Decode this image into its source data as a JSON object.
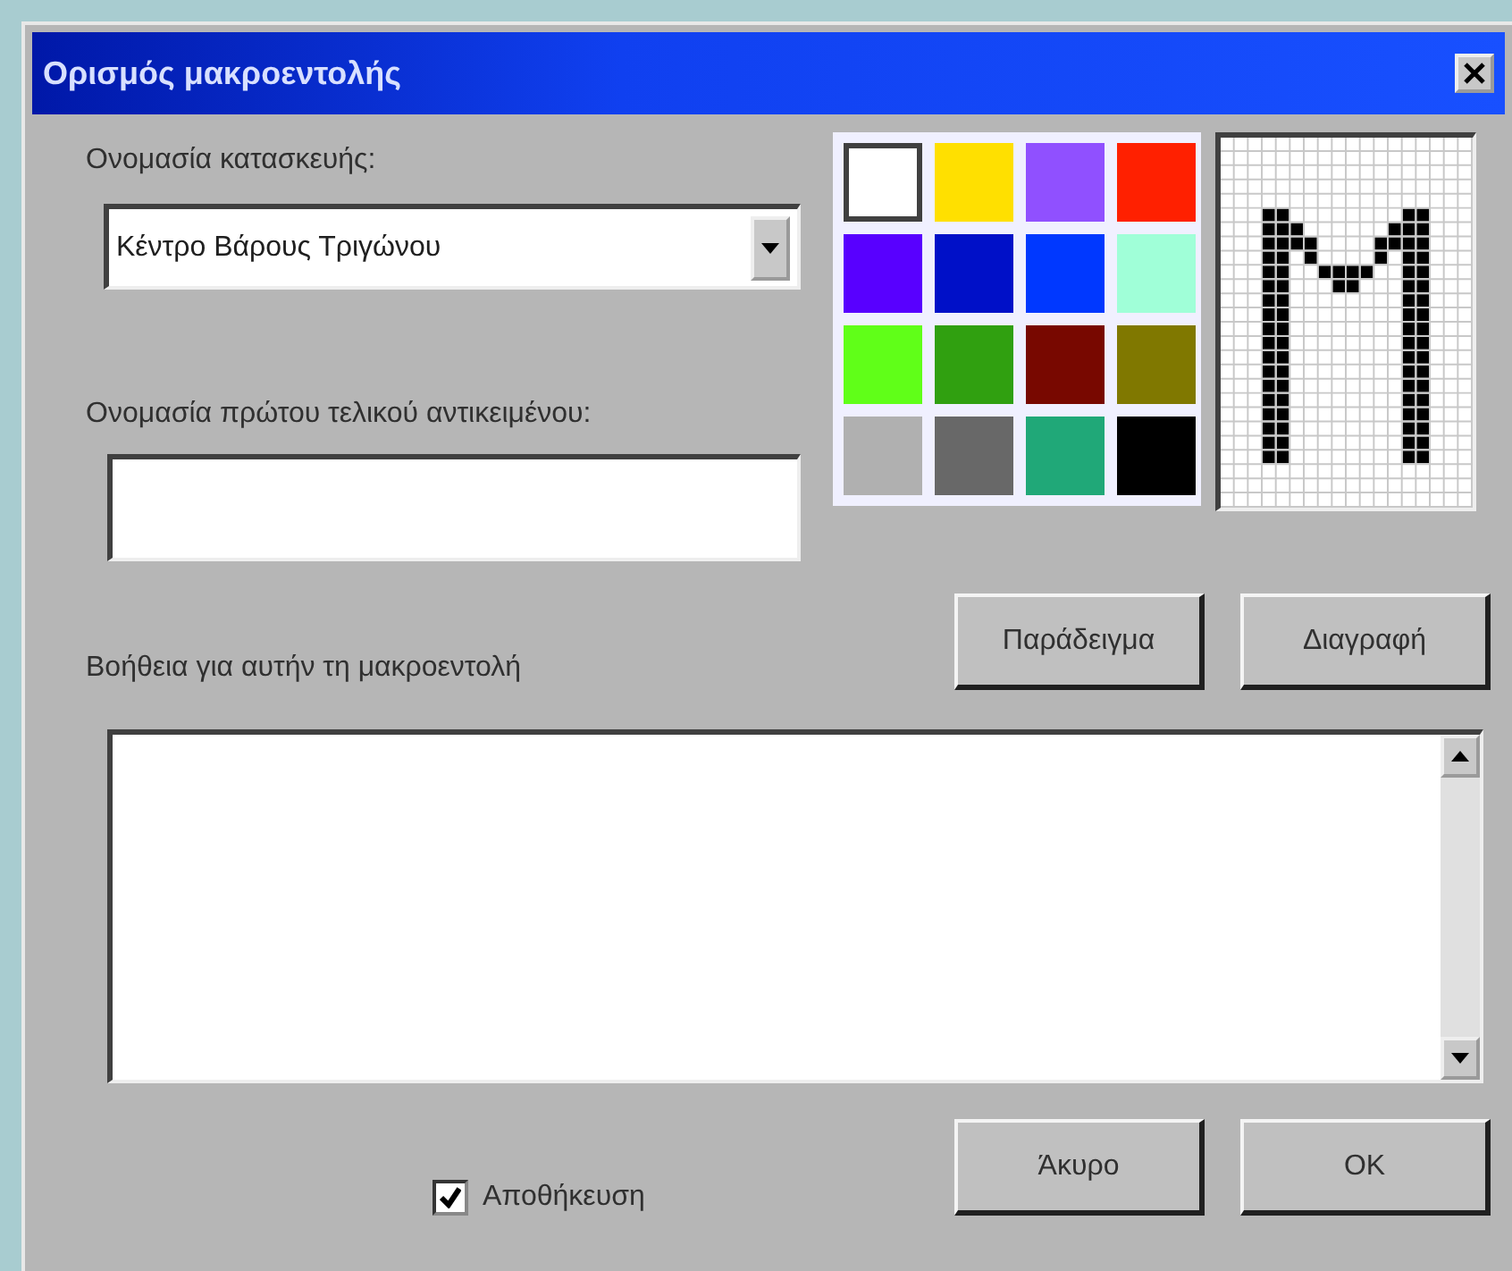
{
  "window": {
    "title": "Ορισμός μακροεντολής"
  },
  "construction_name": {
    "label": "Ονομασία κατασκευής:",
    "value": "Κέντρο Βάρους Τριγώνου"
  },
  "first_object_name": {
    "label": "Ονομασία πρώτου τελικού αντικειμένου:"
  },
  "colors": [
    {
      "color": "#ffffff",
      "selected": true
    },
    {
      "color": "#ffe000",
      "selected": false
    },
    {
      "color": "#9050ff",
      "selected": false
    },
    {
      "color": "#ff2000",
      "selected": false
    },
    {
      "color": "#5800ff",
      "selected": false
    },
    {
      "color": "#0010c8",
      "selected": false
    },
    {
      "color": "#0038ff",
      "selected": false
    },
    {
      "color": "#a0ffd8",
      "selected": false
    },
    {
      "color": "#60ff18",
      "selected": false
    },
    {
      "color": "#30a010",
      "selected": false
    },
    {
      "color": "#780800",
      "selected": false
    },
    {
      "color": "#807800",
      "selected": false
    },
    {
      "color": "#b0b0b0",
      "selected": false
    },
    {
      "color": "#686868",
      "selected": false
    },
    {
      "color": "#20a878",
      "selected": false
    },
    {
      "color": "#000000",
      "selected": false
    }
  ],
  "preview_buttons": [
    "Παράδειγμα",
    "Διαγραφή"
  ],
  "help": {
    "label": "Βοήθεια για αυτήν τη μακροεντολή"
  },
  "save": {
    "label": "Αποθήκευση",
    "checked": true
  },
  "buttons": [
    "Άκυρο",
    "OK"
  ]
}
